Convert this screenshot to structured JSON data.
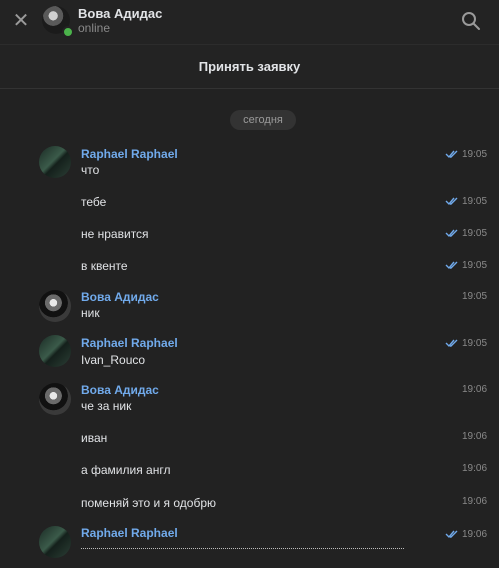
{
  "header": {
    "name": "Вова Адидас",
    "status": "online"
  },
  "accept_label": "Принять заявку",
  "date_label": "сегодня",
  "messages": [
    {
      "author": "Raphael Raphael",
      "text": "что",
      "time": "19:05",
      "read": true
    },
    {
      "author": "",
      "text": "тебе",
      "time": "19:05",
      "read": true
    },
    {
      "author": "",
      "text": "не нравится",
      "time": "19:05",
      "read": true
    },
    {
      "author": "",
      "text": "в квенте",
      "time": "19:05",
      "read": true
    },
    {
      "author": "Вова Адидас",
      "text": "ник",
      "time": "19:05",
      "read": false
    },
    {
      "author": "Raphael Raphael",
      "text": "Ivan_Rouco",
      "time": "19:05",
      "read": true
    },
    {
      "author": "Вова Адидас",
      "text": "че за ник",
      "time": "19:06",
      "read": false
    },
    {
      "author": "",
      "text": "иван",
      "time": "19:06",
      "read": false
    },
    {
      "author": "",
      "text": "а фамилия англ",
      "time": "19:06",
      "read": false
    },
    {
      "author": "",
      "text": "поменяй это и я одобрю",
      "time": "19:06",
      "read": false
    },
    {
      "author": "Raphael Raphael",
      "text": "",
      "time": "19:06",
      "read": true
    }
  ],
  "colors": {
    "background": "#222222",
    "author": "#71aaeb",
    "check": "#71aaeb",
    "online": "#4bb34b"
  },
  "icons": [
    "close-icon",
    "search-icon",
    "double-check-icon"
  ]
}
